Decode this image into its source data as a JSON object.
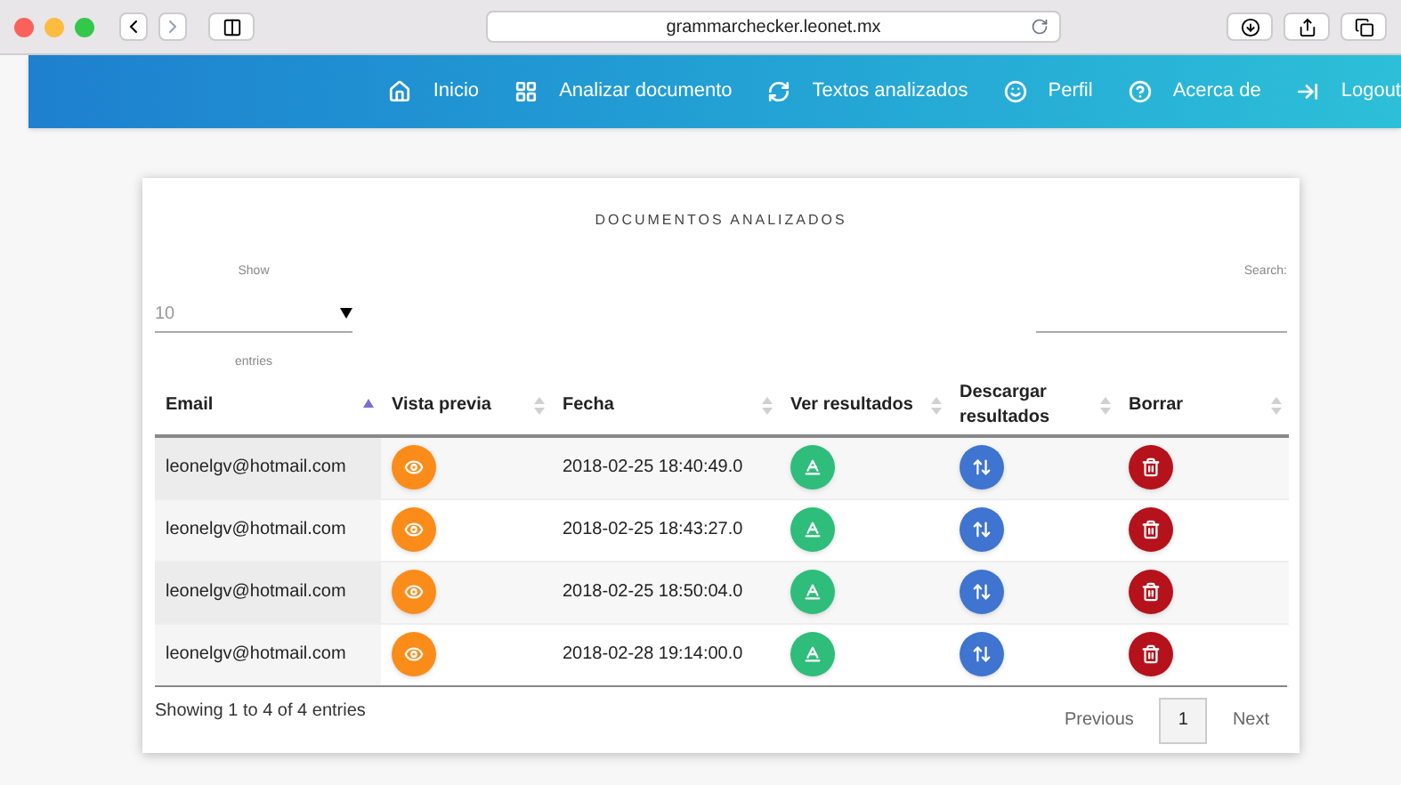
{
  "browser": {
    "url": "grammarchecker.leonet.mx"
  },
  "nav": {
    "items": [
      {
        "label": "Inicio"
      },
      {
        "label": "Analizar documento"
      },
      {
        "label": "Textos analizados"
      },
      {
        "label": "Perfil"
      },
      {
        "label": "Acerca de"
      },
      {
        "label": "Logout"
      }
    ]
  },
  "card": {
    "title": "DOCUMENTOS ANALIZADOS",
    "length_menu": {
      "before": "Show",
      "value": "10",
      "after": "entries"
    },
    "search": {
      "label": "Search:"
    },
    "table": {
      "columns": [
        {
          "label": "Email",
          "kind": "text",
          "sorted": true
        },
        {
          "label": "Vista previa",
          "kind": "action",
          "color": "#fb8c1a",
          "sorted": false
        },
        {
          "label": "Fecha",
          "kind": "text",
          "sorted": false
        },
        {
          "label": "Ver resultados",
          "kind": "action",
          "color": "#2ebd7a",
          "sorted": false
        },
        {
          "label": "Descargar resultados",
          "kind": "action",
          "color": "#3f74d0",
          "sorted": false
        },
        {
          "label": "Borrar",
          "kind": "action",
          "color": "#b5121b",
          "sorted": false
        }
      ],
      "rows": [
        [
          "leonelgv@hotmail.com",
          "",
          "2018-02-25 18:40:49.0",
          "",
          "",
          ""
        ],
        [
          "leonelgv@hotmail.com",
          "",
          "2018-02-25 18:43:27.0",
          "",
          "",
          ""
        ],
        [
          "leonelgv@hotmail.com",
          "",
          "2018-02-25 18:50:04.0",
          "",
          "",
          ""
        ],
        [
          "leonelgv@hotmail.com",
          "",
          "2018-02-28 19:14:00.0",
          "",
          "",
          ""
        ]
      ]
    },
    "info": "Showing 1 to 4 of 4 entries",
    "pagination": [
      {
        "label": "Previous",
        "selected": false
      },
      {
        "label": "1",
        "selected": true
      },
      {
        "label": "Next",
        "selected": false
      }
    ]
  }
}
